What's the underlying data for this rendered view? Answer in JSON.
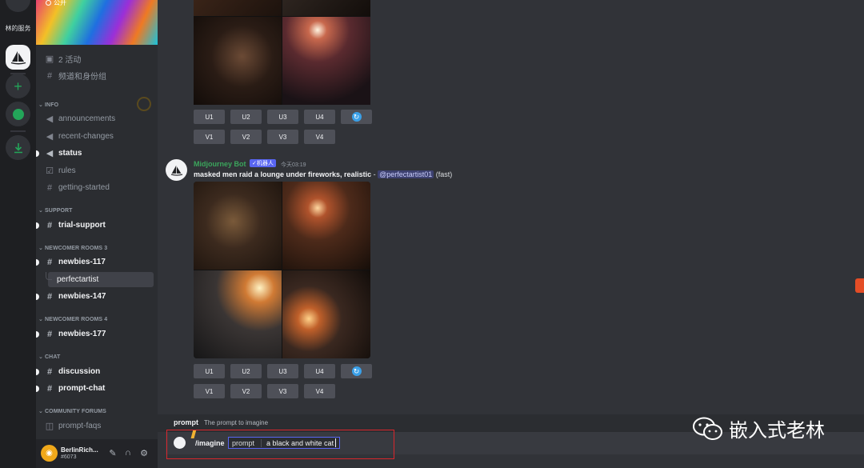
{
  "rail": {
    "server_label": "林的服务"
  },
  "sidebar": {
    "banner_tag": "公开",
    "top_items": [
      {
        "label": "2 活动"
      },
      {
        "label": "频道和身份组"
      }
    ],
    "categories": {
      "info": "INFO",
      "support": "SUPPORT",
      "newcomer3": "NEWCOMER ROOMS 3",
      "newcomer4": "NEWCOMER ROOMS 4",
      "chat": "CHAT",
      "forums": "COMMUNITY FORUMS"
    },
    "channels": {
      "announcements": "announcements",
      "recent_changes": "recent-changes",
      "status": "status",
      "rules": "rules",
      "getting_started": "getting-started",
      "trial_support": "trial-support",
      "newbies117": "newbies-117",
      "perfectartist": "perfectartist",
      "newbies147": "newbies-147",
      "newbies177": "newbies-177",
      "discussion": "discussion",
      "prompt_chat": "prompt-chat",
      "prompt_faqs": "prompt-faqs"
    }
  },
  "user": {
    "name": "BerlinRich...",
    "tag": "#6073"
  },
  "upscale_buttons": [
    "U1",
    "U2",
    "U3",
    "U4"
  ],
  "variation_buttons": [
    "V1",
    "V2",
    "V3",
    "V4"
  ],
  "message": {
    "bot_name": "Midjourney Bot",
    "bot_badge": "✓机器人",
    "time": "今天03:19",
    "prompt_text": "masked men raid a lounge under fireworks, realistic",
    "separator": " - ",
    "mention": "@perfectartist01",
    "mode": " (fast)"
  },
  "hint": {
    "key": "prompt",
    "desc": "The prompt to imagine"
  },
  "composer": {
    "command": "/imagine",
    "param_name": "prompt",
    "param_value": "a black and white cat"
  },
  "watermark": {
    "text": "嵌入式老林"
  },
  "colors": {
    "accent": "#5865f2",
    "bot_green": "#3ba55c",
    "highlight_box": "#d9262c"
  }
}
